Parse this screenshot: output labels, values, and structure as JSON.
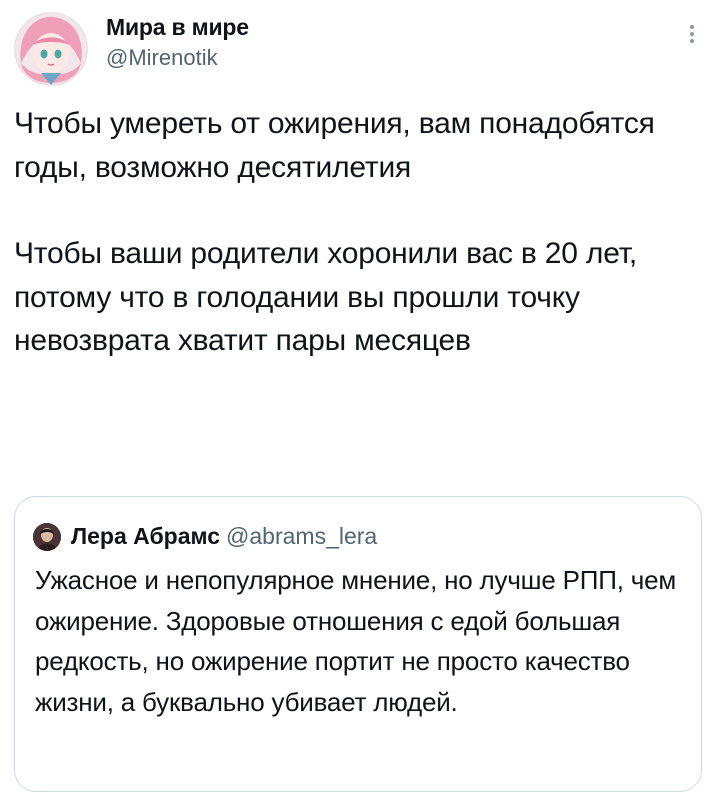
{
  "tweet": {
    "author": {
      "display_name": "Мира в мире",
      "handle": "@Mirenotik"
    },
    "paragraphs": [
      "Чтобы умереть от ожирения, вам понадобятся годы, возможно десятилетия",
      "Чтобы ваши родители хоронили вас в 20 лет, потому что в голодании вы прошли точку невозврата хватит пары месяцев"
    ],
    "menu_icon": "more-vertical-icon"
  },
  "quoted_tweet": {
    "author": {
      "display_name": "Лера Абрамс",
      "handle": "@abrams_lera"
    },
    "text": "Ужасное и непопулярное мнение, но лучше РПП, чем ожирение. Здоровые отношения с едой большая редкость, но ожирение портит не просто качество жизни, а буквально убивает людей."
  },
  "colors": {
    "text": "#0f1419",
    "secondary": "#536471",
    "border": "#cfd9de"
  }
}
